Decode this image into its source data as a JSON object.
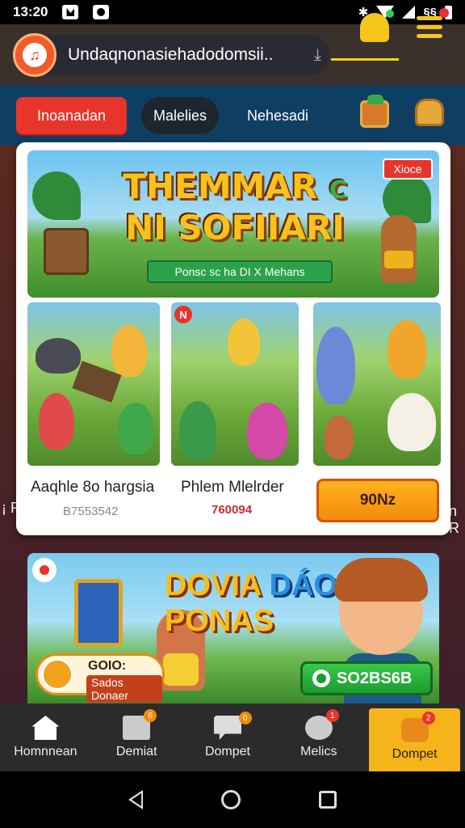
{
  "status_bar": {
    "time": "13:20",
    "indicator": "§§"
  },
  "topbar": {
    "url": "Undaqnonasiehadodomsii..",
    "share_glyph": "⤓"
  },
  "tabs": [
    {
      "label": "Inoanadan"
    },
    {
      "label": "Malelies"
    },
    {
      "label": "Nehesadi"
    }
  ],
  "edge": {
    "left_text": "¡ R",
    "right_text": "n R"
  },
  "hero": {
    "title_line1": "THEMMAR",
    "title_accent": "C",
    "title_line2": "NI SOFIIARI",
    "ribbon": "Ponsc sc ha DI X Mehans",
    "badge": "Xioce"
  },
  "games": [
    {
      "title": "Aaqhle 8o hargsia",
      "sub": "B7553542"
    },
    {
      "title": "Phlem Mlelrder",
      "sub": "760094"
    }
  ],
  "cta": {
    "label": "90Nz"
  },
  "banner2": {
    "title_line1": "DOVIA",
    "title_accent": "DÁO",
    "title_line2": "PONAS",
    "coin_line1": "GOIO:",
    "coin_line2": "Sados Donaer",
    "green_label": "SO2BS6B"
  },
  "bottom_nav": [
    {
      "label": "Homnnean",
      "icon": "home-icon"
    },
    {
      "label": "Demiat",
      "icon": "list-icon",
      "badge": "6"
    },
    {
      "label": "Dompet",
      "icon": "chat-icon",
      "badge": "0"
    },
    {
      "label": "Melics",
      "icon": "robot-icon",
      "badge": "1"
    },
    {
      "label": "Dompet",
      "icon": "face-icon",
      "badge": "2"
    }
  ],
  "colors": {
    "accent_red": "#e8352c",
    "accent_yellow": "#f5b51a",
    "tabs_bg": "#0f3e63",
    "topbar_bg": "#3a302c"
  }
}
